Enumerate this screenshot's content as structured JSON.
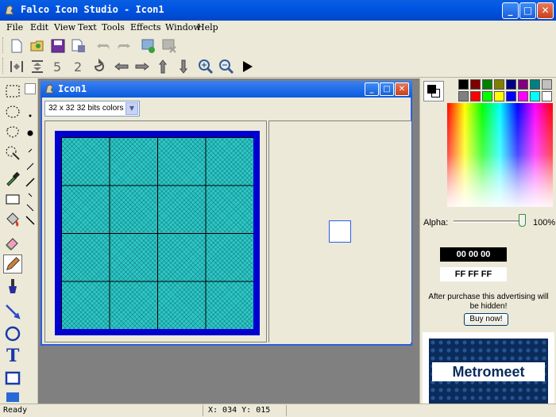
{
  "app": {
    "title": "Falco Icon Studio - Icon1"
  },
  "menu": [
    "File",
    "Edit",
    "View",
    "Text",
    "Tools",
    "Effects",
    "Window",
    "Help"
  ],
  "toolbar_row1": [
    "new-icon",
    "open-folder-icon",
    "save-icon",
    "save-as-icon",
    "undo-icon",
    "redo-icon",
    "add-image-icon",
    "delete-image-icon"
  ],
  "toolbar_row2": [
    "flip-horizontal-icon",
    "flip-vertical-icon",
    "rotate-left-icon",
    "rotate-right-icon",
    "rotate-icon",
    "shift-left-icon",
    "shift-right-icon",
    "shift-up-icon",
    "shift-down-icon",
    "zoom-in-icon",
    "zoom-out-icon",
    "play-icon"
  ],
  "tools": [
    "rect-select-icon",
    "ellipse-select-icon",
    "lasso-select-icon",
    "magic-wand-icon",
    "eyedropper-icon",
    "rectangle-icon",
    "fill-bucket-icon",
    "eraser-icon",
    "pencil-icon",
    "brush-icon",
    "line-icon",
    "ellipse-icon",
    "text-icon",
    "filled-rect-icon",
    "gradient-icon"
  ],
  "child_window": {
    "title": "Icon1",
    "format_selected": "32 x 32 32 bits colors"
  },
  "color_panel": {
    "palette": [
      "#000000",
      "#800000",
      "#008000",
      "#808000",
      "#000080",
      "#800080",
      "#008080",
      "#c0c0c0",
      "#808080",
      "#ff0000",
      "#00ff00",
      "#ffff00",
      "#0000ff",
      "#ff00ff",
      "#00ffff",
      "#ffffff"
    ],
    "alpha_label": "Alpha:",
    "alpha_value": "100%",
    "alpha_level": 1.0,
    "fg_hex": "00 00 00",
    "bg_hex": "FF FF FF",
    "ad_text": "After purchase this advertising will be hidden!",
    "buy_button": "Buy now!",
    "ad_brand": "Metromeet"
  },
  "status": {
    "text": "Ready",
    "coords": "X: 034 Y: 015"
  }
}
